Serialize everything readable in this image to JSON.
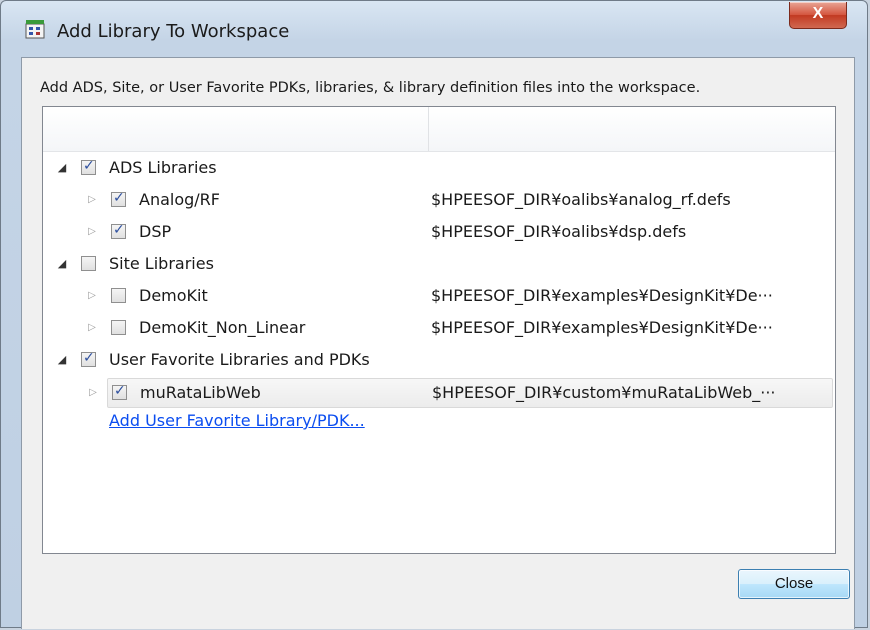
{
  "window": {
    "title": "Add Library To Workspace",
    "close_glyph": "X"
  },
  "description": "Add ADS, Site, or User Favorite PDKs, libraries, & library definition files into the workspace.",
  "tree": {
    "rows": [
      {
        "label": "ADS Libraries",
        "path": "",
        "checked": true,
        "level": 0,
        "expanded": true
      },
      {
        "label": "Analog/RF",
        "path": "$HPEESOF_DIR¥oalibs¥analog_rf.defs",
        "checked": true,
        "level": 1,
        "expanded": false
      },
      {
        "label": "DSP",
        "path": "$HPEESOF_DIR¥oalibs¥dsp.defs",
        "checked": true,
        "level": 1,
        "expanded": false
      },
      {
        "label": "Site Libraries",
        "path": "",
        "checked": false,
        "level": 0,
        "expanded": true
      },
      {
        "label": "DemoKit",
        "path": "$HPEESOF_DIR¥examples¥DesignKit¥De···",
        "checked": false,
        "level": 1,
        "expanded": false
      },
      {
        "label": "DemoKit_Non_Linear",
        "path": "$HPEESOF_DIR¥examples¥DesignKit¥De···",
        "checked": false,
        "level": 1,
        "expanded": false
      },
      {
        "label": "User Favorite Libraries and PDKs",
        "path": "",
        "checked": true,
        "level": 0,
        "expanded": true
      },
      {
        "label": "muRataLibWeb",
        "path": "$HPEESOF_DIR¥custom¥muRataLibWeb_···",
        "checked": true,
        "level": 1,
        "expanded": false,
        "selected": true
      }
    ],
    "add_link": "Add User Favorite Library/PDK..."
  },
  "buttons": {
    "close": "Close"
  }
}
